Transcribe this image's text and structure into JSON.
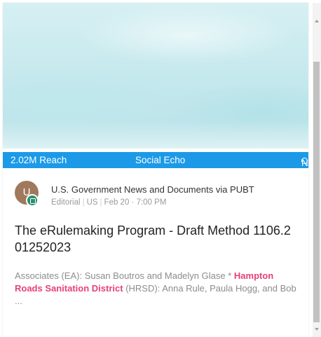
{
  "card": {
    "stats_bar": {
      "reach": "2.02M Reach",
      "echo": "Social Echo",
      "sentiment": "Neutral",
      "sentiment_icon": "neutral-ring-icon",
      "bar_color": "#1c9ae8"
    },
    "avatar": {
      "initial": "U",
      "badge_icon": "document-icon"
    },
    "source": "U.S. Government News and Documents via PUBT",
    "meta": {
      "type": "Editorial",
      "country": "US",
      "datetime": "Feb 20 · 7:00 PM"
    },
    "title": "The eRulemaking Program - Draft Method 1106.2 01252023",
    "snippet": {
      "before": "Associates (EA): Susan Boutros and Madelyn Glase * ",
      "highlight": "Hampton Roads Sanitation District",
      "after": " (HRSD): Anna Rule, Paula Hogg, and Bob ..."
    },
    "highlight_color": "#e8407a"
  }
}
